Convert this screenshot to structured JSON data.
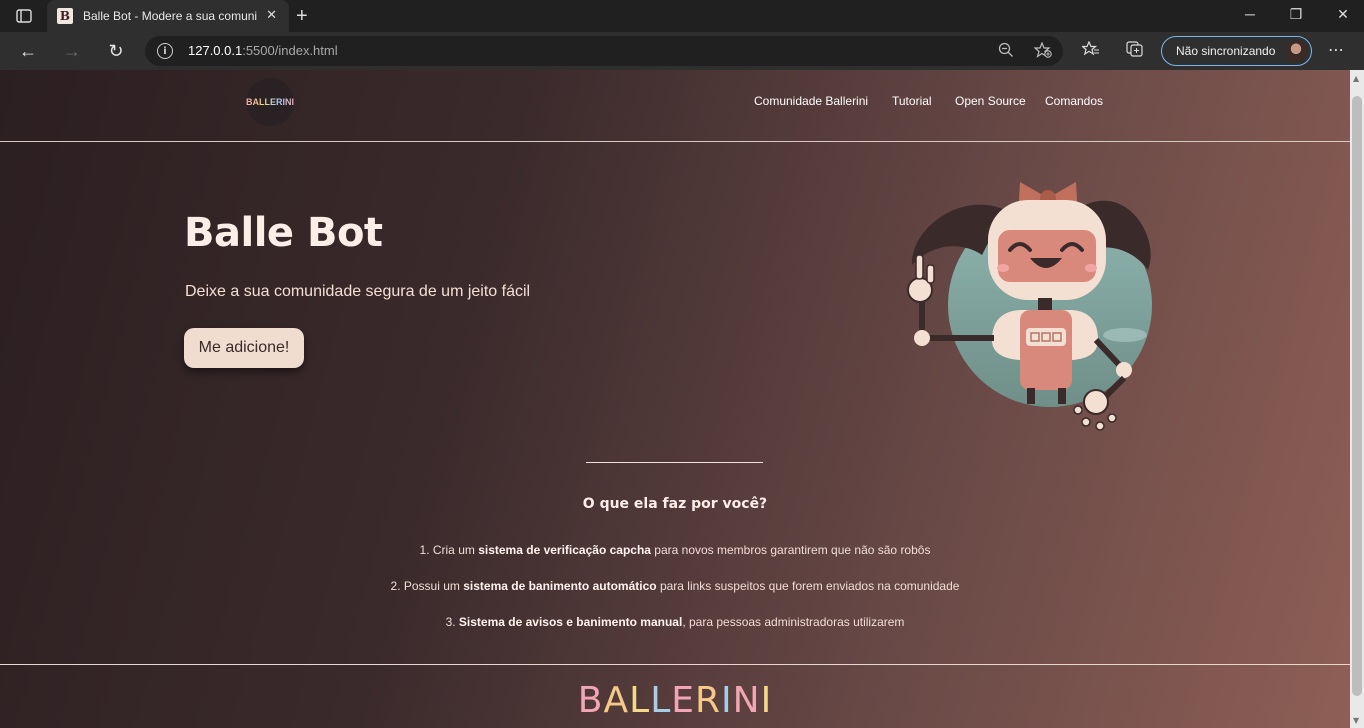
{
  "browser": {
    "tab_title": "Balle Bot - Modere a sua comuni",
    "favicon_letter": "B",
    "url_host": "127.0.0.1",
    "url_path": ":5500/index.html",
    "sync_label": "Não sincronizando",
    "icons": [
      "tab-actions-icon",
      "close-icon",
      "new-tab-icon",
      "minimize-icon",
      "restore-icon",
      "window-close-icon",
      "back-icon",
      "forward-icon",
      "refresh-icon",
      "site-info-icon",
      "zoom-icon",
      "add-favorite-icon",
      "favorites-icon",
      "collections-icon",
      "more-icon"
    ]
  },
  "site": {
    "logo_text": "BALLERINI",
    "nav": [
      "Comunidade Ballerini",
      "Tutorial",
      "Open Source",
      "Comandos"
    ],
    "hero": {
      "title": "Balle Bot",
      "subtitle": "Deixe a sua comunidade segura de um jeito fácil",
      "cta": "Me adicione!"
    },
    "features_title": "O que ela faz por você?",
    "features": [
      {
        "pre": "1. Cria um ",
        "bold": "sistema de verificação capcha",
        "post": " para novos membros garantirem que não são robôs"
      },
      {
        "pre": "2. Possui um ",
        "bold": "sistema de banimento automático",
        "post": " para links suspeitos que forem enviados na comunidade"
      },
      {
        "pre": "3. ",
        "bold": "Sistema de avisos e banimento manual",
        "post": ", para pessoas administradoras utilizarem"
      }
    ],
    "footer_logo": [
      "B",
      "A",
      "L",
      "L",
      "E",
      "R",
      "I",
      "N",
      "I"
    ],
    "footer_colors": [
      "#f2a5b3",
      "#f4c98a",
      "#f6d88a",
      "#a8cde8",
      "#f2a5b3",
      "#f4c98a",
      "#a8cde8",
      "#f2a5b3",
      "#f6d88a"
    ]
  }
}
